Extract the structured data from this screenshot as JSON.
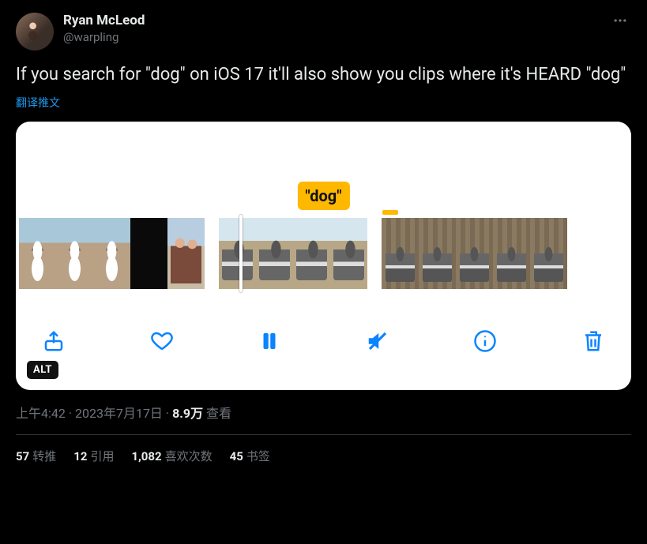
{
  "user": {
    "display_name": "Ryan McLeod",
    "handle": "@warpling"
  },
  "tweet": {
    "text": "If you search for \"dog\" on iOS 17 it'll also show you clips where it's HEARD \"dog\"",
    "translate_label": "翻译推文"
  },
  "media": {
    "search_highlight": "\"dog\"",
    "alt_badge": "ALT",
    "toolbar": {
      "share": "share",
      "like": "like",
      "pause": "pause",
      "mute": "mute",
      "info": "info",
      "delete": "delete"
    }
  },
  "meta": {
    "time": "上午4:42",
    "date": "2023年7月17日",
    "views_count": "8.9万",
    "views_label": "查看",
    "separator": " · "
  },
  "stats": {
    "retweets_count": "57",
    "retweets_label": "转推",
    "quotes_count": "12",
    "quotes_label": "引用",
    "likes_count": "1,082",
    "likes_label": "喜欢次数",
    "bookmarks_count": "45",
    "bookmarks_label": "书签"
  }
}
